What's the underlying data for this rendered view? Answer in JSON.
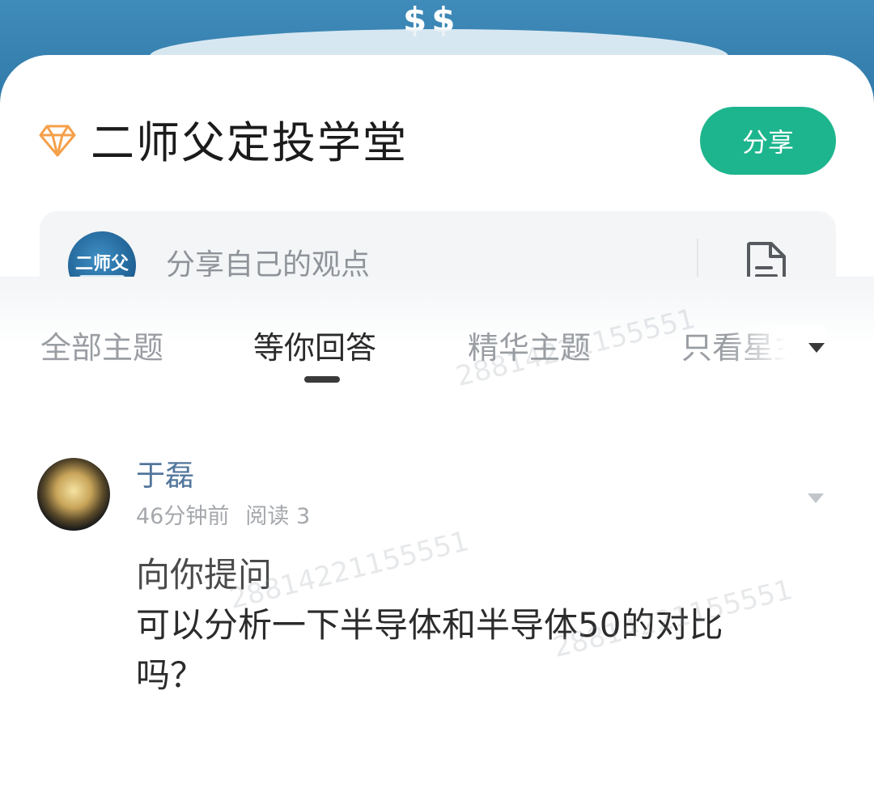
{
  "group": {
    "title": "二师父定投学堂",
    "share_label": "分享",
    "avatar_text": "二师父"
  },
  "compose": {
    "placeholder": "分享自己的观点"
  },
  "tabs": [
    {
      "label": "全部主题"
    },
    {
      "label": "等你回答"
    },
    {
      "label": "精华主题"
    },
    {
      "label": "只看星主"
    }
  ],
  "active_tab_index": 1,
  "post": {
    "username": "于磊",
    "time": "46分钟前",
    "reads": "阅读 3",
    "question_title": "向你提问",
    "question_text": "可以分析一下半导体和半导体50的对比吗？"
  },
  "watermark": "28814221155551",
  "colors": {
    "accent": "#1db58e",
    "username": "#52769c",
    "banner": "#3f8bb9",
    "gem": "#f5a04a"
  }
}
